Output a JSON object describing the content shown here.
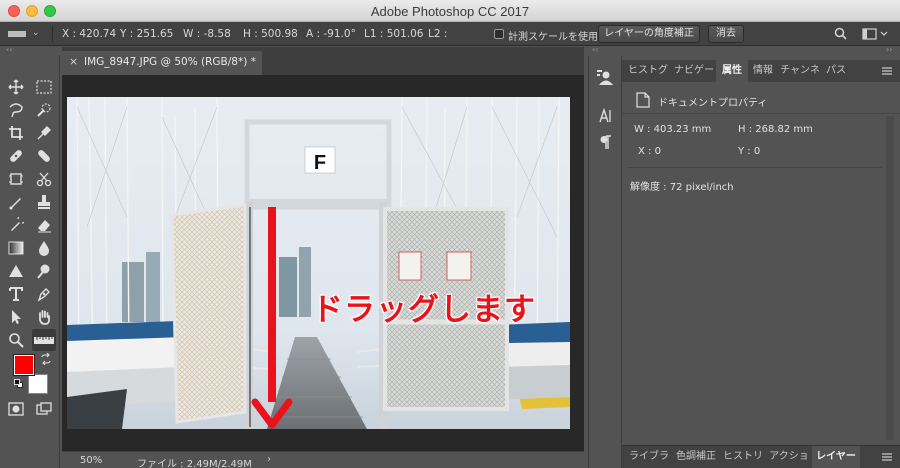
{
  "window": {
    "title": "Adobe Photoshop CC 2017"
  },
  "options_bar": {
    "x": "X : 420.74",
    "y": "Y : 251.65",
    "w": "W : -8.58",
    "h": "H : 500.98",
    "a": "A : -91.0°",
    "l1": "L1 : 501.06",
    "l2": "L2 :",
    "use_measurement_scale": "計測スケールを使用",
    "straighten_layer": "レイヤーの角度補正",
    "clear": "消去"
  },
  "document": {
    "tab_title": "IMG_8947.JPG @ 50% (RGB/8*) *",
    "overlay_text": "ドラッグします"
  },
  "status_bar": {
    "zoom": "50%",
    "file_info": "ファイル : 2.49M/2.49M",
    "arrow": "›"
  },
  "panel": {
    "tabs": [
      "ヒストグ",
      "ナビゲー",
      "属性",
      "情報",
      "チャンネ",
      "パス"
    ],
    "active_tab": "属性",
    "properties_title": "ドキュメントプロパティ",
    "w": "W : 403.23 mm",
    "h": "H : 268.82 mm",
    "x": "X : 0",
    "y": "Y : 0",
    "resolution": "解像度 : 72 pixel/inch",
    "bottom_tabs": [
      "ライブラ",
      "色調補正",
      "ヒストリ",
      "アクショ",
      "レイヤー"
    ]
  },
  "colors": {
    "foreground": "#ff0000",
    "background": "#ffffff",
    "annotation_red": "#e8131b"
  },
  "dock_icons": [
    "workspace-icon",
    "character-icon",
    "paragraph-icon"
  ]
}
